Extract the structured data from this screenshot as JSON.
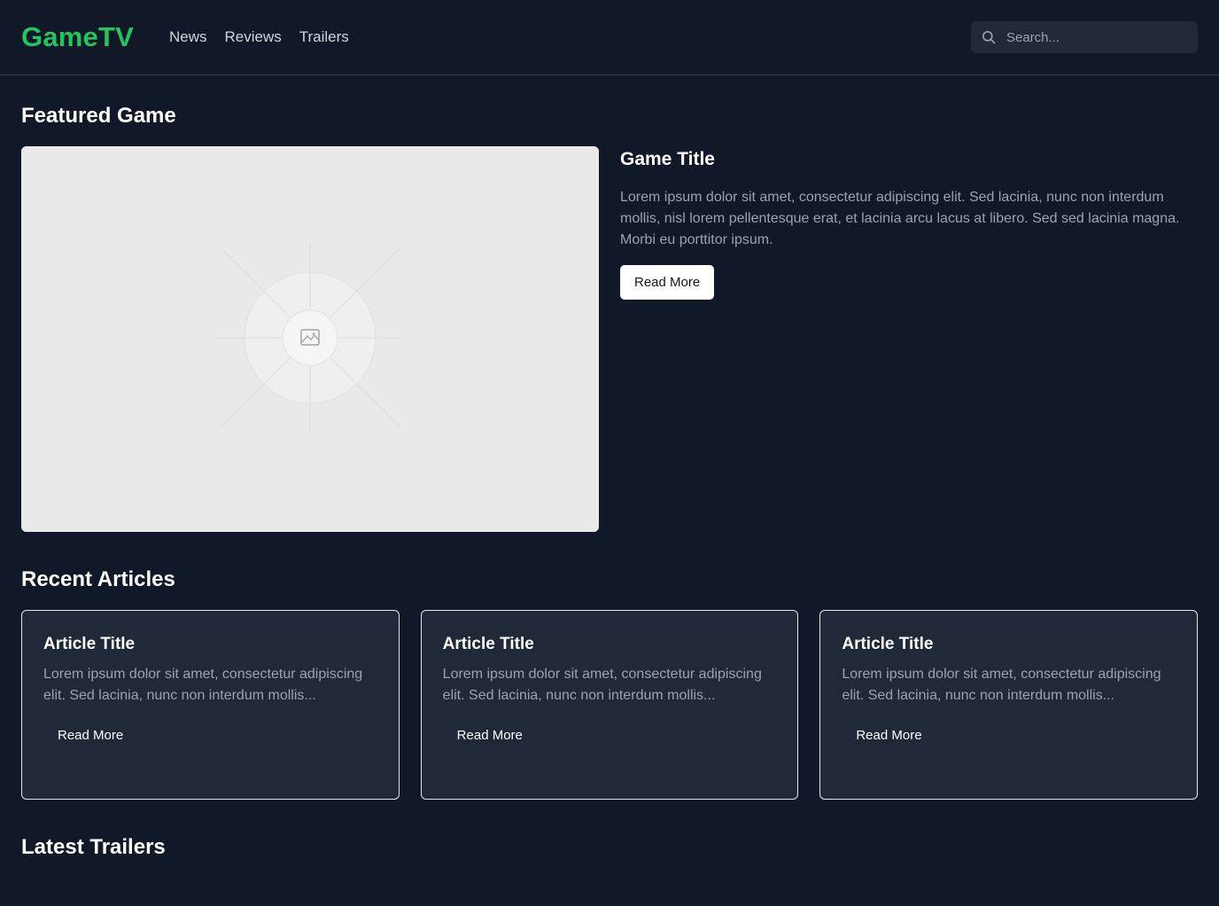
{
  "header": {
    "logo": "GameTV",
    "nav": [
      "News",
      "Reviews",
      "Trailers"
    ],
    "search_placeholder": "Search...",
    "search_icon": "search-icon"
  },
  "colors": {
    "background": "#111827",
    "surface": "#1f2937",
    "brand": "#22c55e",
    "muted_text": "#9ca3af"
  },
  "featured": {
    "section_title": "Featured Game",
    "image_icon": "image-placeholder-icon",
    "title": "Game Title",
    "description": "Lorem ipsum dolor sit amet, consectetur adipiscing elit. Sed lacinia, nunc non interdum mollis, nisl lorem pellentesque erat, et lacinia arcu lacus at libero. Sed sed lacinia magna. Morbi eu porttitor ipsum.",
    "button": "Read More"
  },
  "recent": {
    "section_title": "Recent Articles",
    "articles": [
      {
        "title": "Article Title",
        "excerpt": "Lorem ipsum dolor sit amet, consectetur adipiscing elit. Sed lacinia, nunc non interdum mollis...",
        "button": "Read More"
      },
      {
        "title": "Article Title",
        "excerpt": "Lorem ipsum dolor sit amet, consectetur adipiscing elit. Sed lacinia, nunc non interdum mollis...",
        "button": "Read More"
      },
      {
        "title": "Article Title",
        "excerpt": "Lorem ipsum dolor sit amet, consectetur adipiscing elit. Sed lacinia, nunc non interdum mollis...",
        "button": "Read More"
      }
    ]
  },
  "trailers": {
    "section_title": "Latest Trailers"
  }
}
